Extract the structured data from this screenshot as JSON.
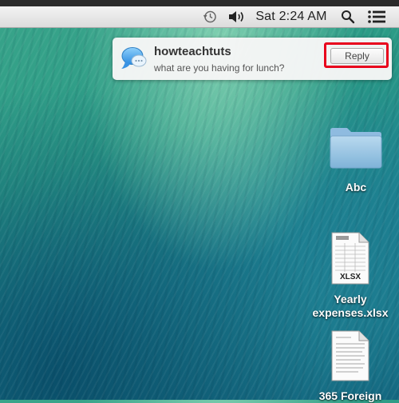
{
  "menubar": {
    "clock": "Sat 2:24 AM",
    "icons": [
      "time-machine-icon",
      "volume-icon",
      "spotlight-search-icon",
      "notification-center-icon"
    ]
  },
  "notification": {
    "app_icon": "messages-icon",
    "title": "howteachtuts",
    "message": "what are you having for lunch?",
    "reply_label": "Reply",
    "highlight_color": "#e8001c"
  },
  "desktop": {
    "items": [
      {
        "label": "Abc",
        "icon": "folder-icon"
      },
      {
        "label_line1": "Yearly",
        "label_line2": "expenses.xlsx",
        "icon": "xlsx-file-icon",
        "badge": "XLSX"
      },
      {
        "label": "365 Foreign",
        "icon": "document-file-icon"
      }
    ]
  },
  "colors": {
    "wallpaper": "#2a9a86",
    "menubar": "#e6e6e6"
  }
}
